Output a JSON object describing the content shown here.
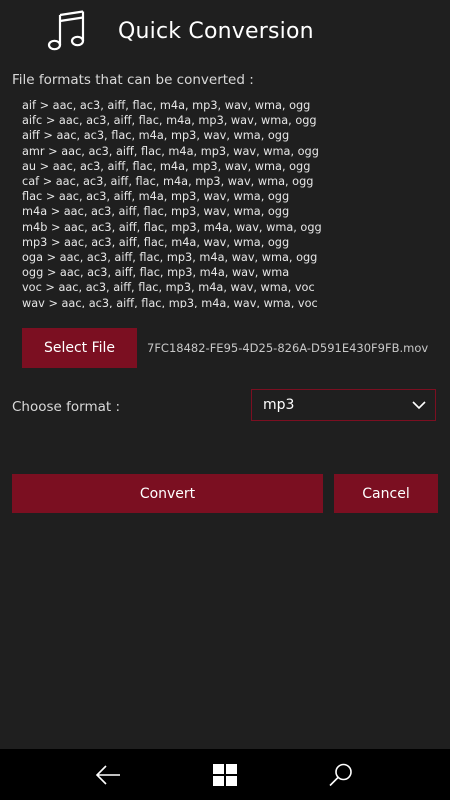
{
  "header": {
    "icon": "music-note-icon",
    "title": "Quick Conversion"
  },
  "formats": {
    "label": "File formats that can be converted :",
    "lines": [
      "aif > aac, ac3, aiff, flac, m4a, mp3, wav, wma, ogg",
      "aifc > aac, ac3, aiff, flac, m4a, mp3, wav, wma, ogg",
      "aiff > aac, ac3, flac, m4a, mp3, wav, wma, ogg",
      "amr > aac, ac3, aiff, flac, m4a, mp3, wav, wma, ogg",
      "au > aac, ac3, aiff, flac, m4a, mp3, wav, wma, ogg",
      "caf > aac, ac3, aiff, flac, m4a, mp3, wav, wma, ogg",
      "flac > aac, ac3, aiff, m4a, mp3, wav, wma, ogg",
      "m4a > aac, ac3, aiff, flac, mp3, wav, wma, ogg",
      "m4b > aac, ac3, aiff, flac, mp3, m4a, wav, wma, ogg",
      "mp3 > aac, ac3, aiff, flac, m4a, wav, wma, ogg",
      "oga > aac, ac3, aiff, flac, mp3, m4a, wav, wma, ogg",
      "ogg > aac, ac3, aiff, flac, mp3, m4a, wav, wma",
      "voc > aac, ac3, aiff, flac, mp3, m4a, wav, wma, voc",
      "wav > aac, ac3, aiff, flac, mp3, m4a, wav, wma, voc"
    ]
  },
  "file": {
    "select_label": "Select File",
    "name": "7FC18482-FE95-4D25-826A-D591E430F9FB.mov"
  },
  "format": {
    "label": "Choose format :",
    "selected": "mp3"
  },
  "actions": {
    "convert_label": "Convert",
    "cancel_label": "Cancel"
  },
  "nav": {
    "back_icon": "back-arrow-icon",
    "home_icon": "windows-logo-icon",
    "search_icon": "search-icon"
  },
  "colors": {
    "background": "#1f1f1f",
    "accent": "#7b0f21",
    "nav_bar": "#000000"
  }
}
